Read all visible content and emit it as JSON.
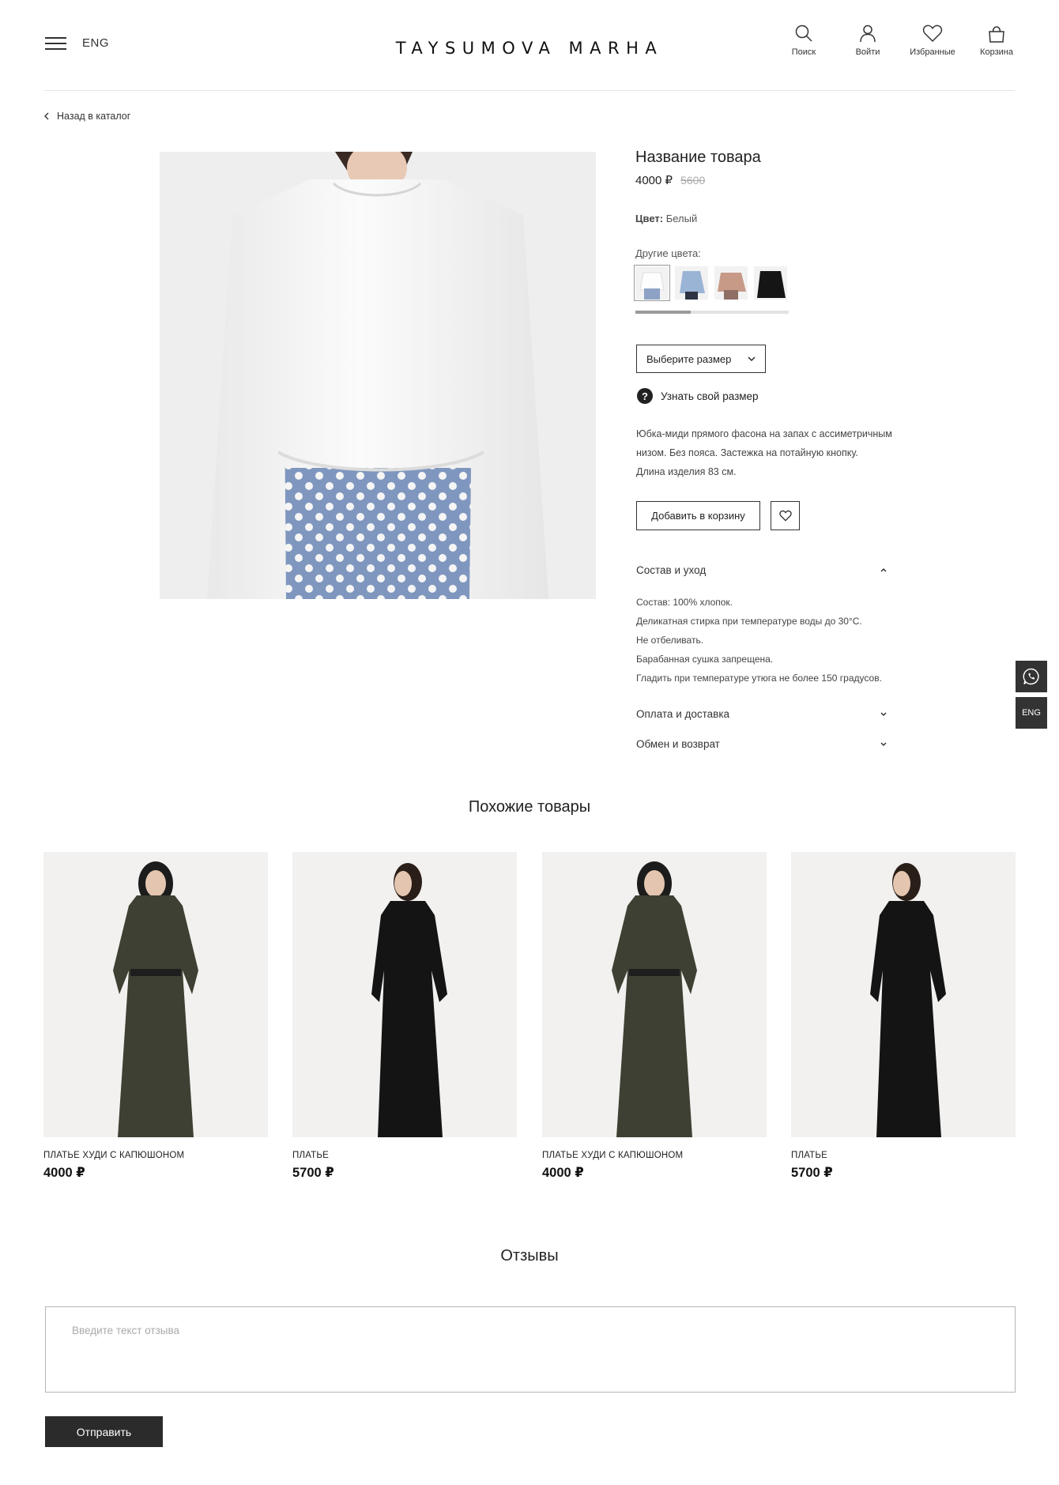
{
  "header": {
    "lang": "ENG",
    "logo": "TAYSUMOVA MARHA",
    "icons": [
      {
        "label": "Поиск",
        "icon": "search-icon"
      },
      {
        "label": "Войти",
        "icon": "user-icon"
      },
      {
        "label": "Избранные",
        "icon": "heart-icon"
      },
      {
        "label": "Корзина",
        "icon": "bag-icon"
      }
    ]
  },
  "breadcrumb": {
    "back": "Назад в каталог"
  },
  "product": {
    "title": "Название товара",
    "price": "4000 ₽",
    "old_price": "5600",
    "color_label": "Цвет:",
    "color_value": "Белый",
    "other_colors": "Другие цвета:",
    "size_select": "Выберите размер",
    "size_help": "Узнать свой размер",
    "description": [
      "Юбка-миди прямого фасона на запах с ассиметричным",
      "низом. Без пояса. Застежка на потайную кнопку.",
      "Длина изделия 83 см."
    ],
    "add_to_cart": "Добавить в корзину",
    "accordion": {
      "composition": "Состав и уход",
      "payment": "Оплата и доставка",
      "exchange": "Обмен и возврат"
    },
    "care": [
      "Состав: 100% хлопок.",
      "Деликатная стирка при температуре воды до 30°C.",
      "Не отбеливать.",
      "Барабанная сушка запрещена.",
      "Гладить при температуре утюга не более 150 градусов."
    ]
  },
  "side": {
    "lang": "ENG"
  },
  "similar": {
    "title": "Похожие товары",
    "items": [
      {
        "name": "ПЛАТЬЕ ХУДИ С КАПЮШОНОМ",
        "price": "4000 ₽"
      },
      {
        "name": "ПЛАТЬЕ",
        "price": "5700 ₽"
      },
      {
        "name": "ПЛАТЬЕ ХУДИ С КАПЮШОНОМ",
        "price": "4000 ₽"
      },
      {
        "name": "ПЛАТЬЕ",
        "price": "5700 ₽"
      }
    ]
  },
  "reviews": {
    "title": "Отзывы",
    "placeholder": "Введите текст отзыва",
    "submit": "Отправить"
  }
}
